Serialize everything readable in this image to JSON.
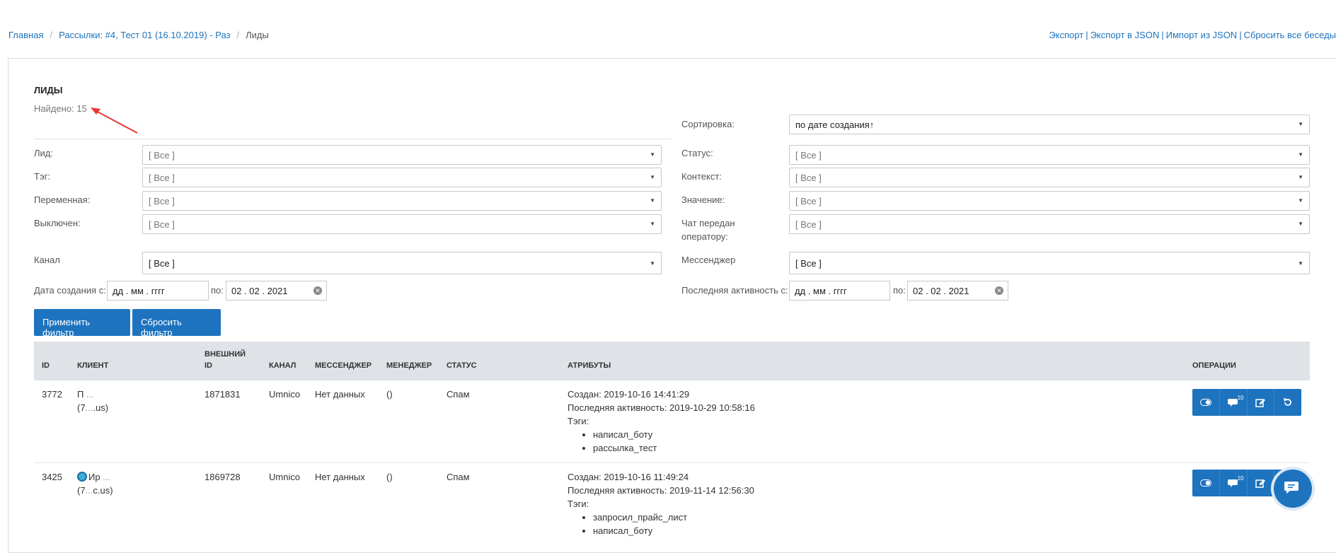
{
  "breadcrumb": {
    "home": "Главная",
    "mailing": "Рассылки: #4, Тест 01 (16.10.2019) - Раз",
    "current": "Лиды"
  },
  "top_links": [
    "Экспорт",
    "Экспорт в JSON",
    "Импорт из JSON",
    "Сбросить все беседы"
  ],
  "page": {
    "title": "ЛИДЫ",
    "found": "Найдено: 15"
  },
  "filters": {
    "sort_label": "Сортировка:",
    "sort_value": "по дате создания↑",
    "lead_label": "Лид:",
    "status_label": "Статус:",
    "tag_label": "Тэг:",
    "context_label": "Контекст:",
    "variable_label": "Переменная:",
    "value_label": "Значение:",
    "disabled_label": "Выключен:",
    "chat_operator_label_1": "Чат передан",
    "chat_operator_label_2": "оператору:",
    "channel_label": "Канал",
    "messenger_label": "Мессенджер",
    "all_placeholder": "[ Все ]",
    "created_from_label": "Дата создания с:",
    "to_label": "по:",
    "activity_from_label": "Последняя активность с:",
    "date_placeholder": "дд . мм . гггг",
    "date_to_value": "02 . 02 . 2021",
    "apply_button": "Применить фильтр",
    "reset_button": "Сбросить фильтр"
  },
  "table": {
    "headers": {
      "id": "ID",
      "client": "КЛИЕНТ",
      "external_id_1": "ВНЕШНИЙ",
      "external_id_2": "ID",
      "channel": "КАНАЛ",
      "messenger": "МЕССЕНДЖЕР",
      "manager": "МЕНЕДЖЕР",
      "status": "СТАТУС",
      "attributes": "АТРИБУТЫ",
      "operations": "ОПЕРАЦИИ"
    },
    "rows": [
      {
        "id": "3772",
        "client_name": "П",
        "client_name_blurred": "...",
        "client_phone": "(7",
        "client_phone_blurred": "...",
        "client_phone_tail": ".us)",
        "external_id": "1871831",
        "channel": "Umnico",
        "messenger": "Нет данных",
        "manager": "()",
        "status": "Спам",
        "created": "Создан: 2019-10-16 14:41:29",
        "last_activity": "Последняя активность: 2019-10-29 10:58:16",
        "tags_label": "Тэги:",
        "tags": [
          "написал_боту",
          "рассылка_тест"
        ],
        "messages_count": "10"
      },
      {
        "id": "3425",
        "client_name": "Ир",
        "client_name_blurred": "...",
        "client_phone": "(7",
        "client_phone_blurred": "...",
        "client_phone_tail": "c.us)",
        "external_id": "1869728",
        "channel": "Umnico",
        "messenger": "Нет данных",
        "manager": "()",
        "status": "Спам",
        "created": "Создан: 2019-10-16 11:49:24",
        "last_activity": "Последняя активность: 2019-11-14 12:56:30",
        "tags_label": "Тэги:",
        "tags": [
          "запросил_прайс_лист",
          "написал_боту"
        ],
        "messages_count": "10"
      }
    ]
  },
  "colors": {
    "accent": "#1e73be",
    "header_bg": "#dfe3e7",
    "arrow": "#e53935"
  },
  "icons": [
    "toggle-icon",
    "comments-icon",
    "edit-icon",
    "reset-icon",
    "chat-icon",
    "clear-icon",
    "globe-icon",
    "caret-down-icon"
  ]
}
